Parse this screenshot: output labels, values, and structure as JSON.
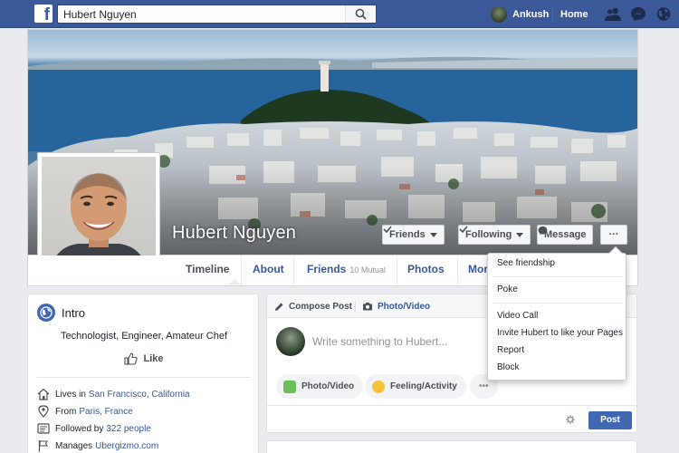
{
  "topbar": {
    "search_value": "Hubert Nguyen",
    "user_name": "Ankush",
    "home_label": "Home"
  },
  "profile": {
    "name": "Hubert Nguyen"
  },
  "cover_actions": {
    "friends_label": "Friends",
    "following_label": "Following",
    "message_label": "Message",
    "more_label": "···"
  },
  "tabs": {
    "timeline": "Timeline",
    "about": "About",
    "friends": "Friends",
    "mutual": "10 Mutual",
    "photos": "Photos",
    "more": "More"
  },
  "intro": {
    "title": "Intro",
    "bio": "Technologist, Engineer, Amateur Chef",
    "like_label": "Like",
    "lives_prefix": "Lives in",
    "lives_link": "San Francisco, California",
    "from_prefix": "From",
    "from_link": "Paris, France",
    "followed_prefix": "Followed by",
    "followed_link": "322 people",
    "manages_prefix": "Manages",
    "manages_link": "Ubergizmo.com"
  },
  "composer": {
    "compose_tab": "Compose Post",
    "photo_tab": "Photo/Video",
    "placeholder": "Write something to Hubert...",
    "photo_pill": "Photo/Video",
    "feeling_pill": "Feeling/Activity",
    "more_pill": "•••",
    "post_label": "Post"
  },
  "dropdown": {
    "items": [
      "See friendship",
      "Poke",
      "Video Call",
      "Invite Hubert to like your Pages",
      "Report",
      "Block"
    ]
  },
  "colors": {
    "brand": "#3b5998",
    "link": "#365899",
    "background": "#e9ebee",
    "post_button": "#4267b2"
  }
}
